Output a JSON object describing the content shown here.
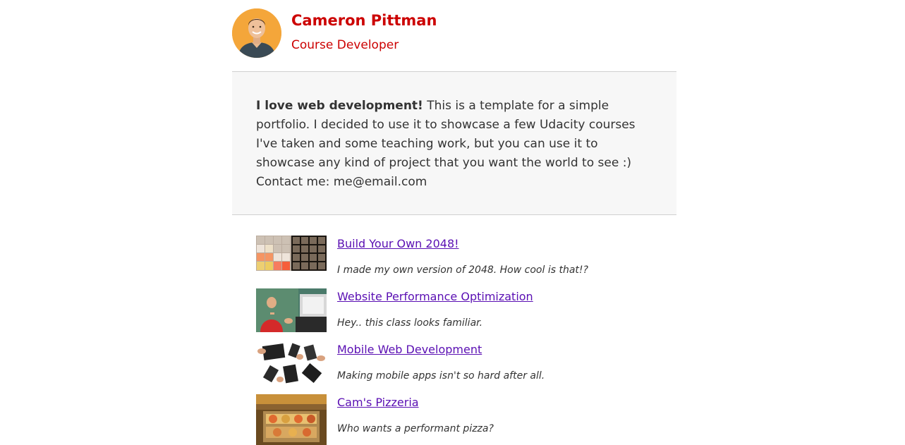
{
  "header": {
    "name": "Cameron Pittman",
    "role": "Course Developer",
    "accent_color": "#cc0000"
  },
  "about": {
    "lead": "I love web development!",
    "text": " This is a template for a simple portfolio. I decided to use it to showcase a few Udacity courses I've taken and some teaching work, but you can use it to showcase any kind of project that you want the world to see :) ",
    "contact_label": "Contact me: ",
    "contact_email": "me@email.com"
  },
  "projects": [
    {
      "title": "Build Your Own 2048!",
      "description": "I made my own version of 2048. How cool is that!?",
      "icon": "2048-game-thumbnail"
    },
    {
      "title": "Website Performance Optimization",
      "description": "Hey.. this class looks familiar.",
      "icon": "instructor-video-thumbnail"
    },
    {
      "title": "Mobile Web Development",
      "description": "Making mobile apps isn't so hard after all.",
      "icon": "mobile-devices-thumbnail"
    },
    {
      "title": "Cam's Pizzeria",
      "description": "Who wants a performant pizza?",
      "icon": "pizzeria-thumbnail"
    }
  ],
  "colors": {
    "link": "#5a0fb3",
    "about_bg": "#f7f7f7",
    "divider": "#d0d0d0"
  }
}
